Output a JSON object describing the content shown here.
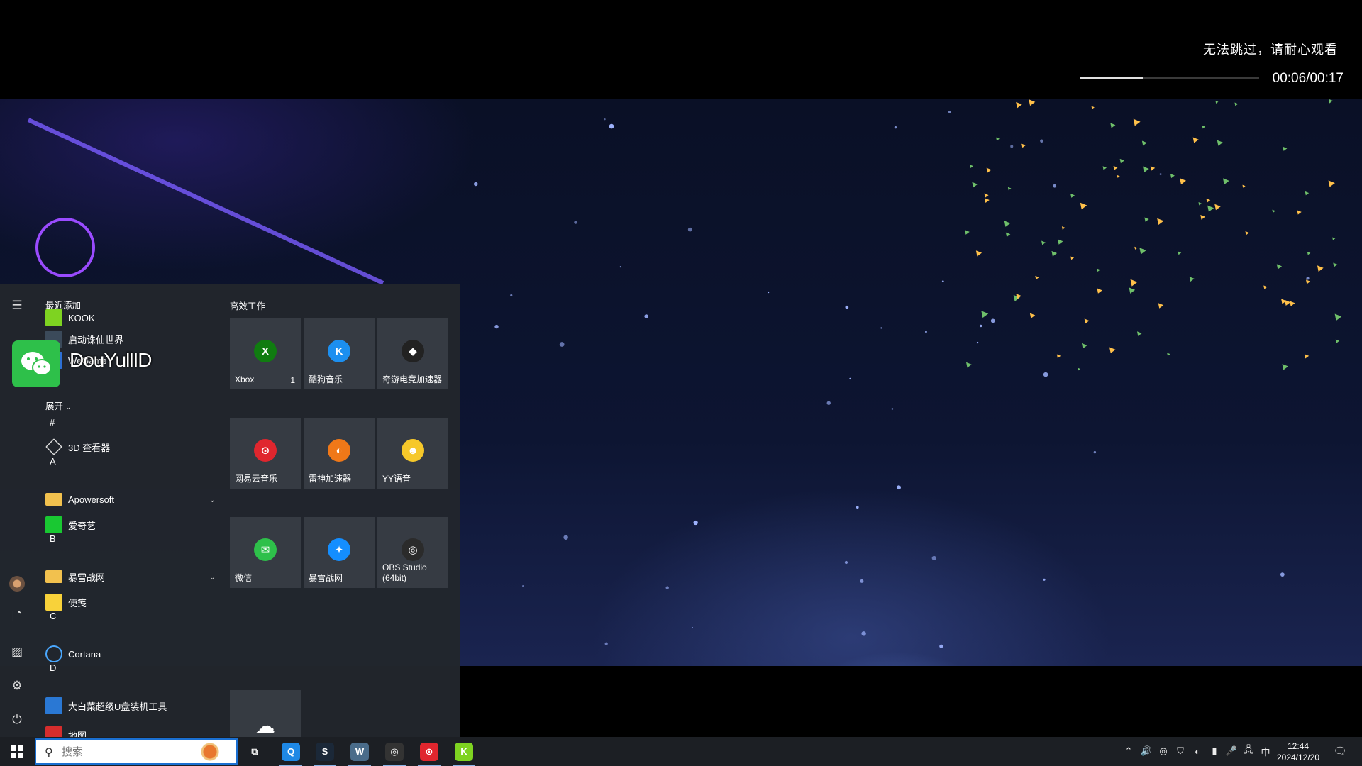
{
  "video": {
    "skip_notice": "无法跳过，请耐心观看",
    "time": "00:06/00:17",
    "progress": 0.35
  },
  "start_menu": {
    "recent_header": "最近添加",
    "expand_label": "展开",
    "recent": [
      {
        "label": "KOOK",
        "icon": "kook-icon",
        "color": "#7ed321"
      },
      {
        "label": "启动诛仙世界",
        "icon": "zhuxian-icon",
        "color": "#3b4a5a"
      },
      {
        "label": "WeGame",
        "icon": "wegame-icon",
        "color": "#2d6fd4"
      }
    ],
    "letters": [
      "#",
      "A",
      "B",
      "C",
      "D"
    ],
    "apps": [
      {
        "label": "3D 查看器",
        "icon": "cube-icon",
        "color": "transparent"
      },
      {
        "label": "Apowersoft",
        "icon": "folder-icon",
        "color": "#f2c14e",
        "expandable": true
      },
      {
        "label": "爱奇艺",
        "icon": "iqiyi-icon",
        "color": "#19c832"
      },
      {
        "label": "暴雪战网",
        "icon": "folder-icon",
        "color": "#f2c14e",
        "expandable": true
      },
      {
        "label": "便笺",
        "icon": "sticky-note-icon",
        "color": "#f8d23a"
      },
      {
        "label": "Cortana",
        "icon": "cortana-icon",
        "color": "transparent"
      },
      {
        "label": "大白菜超级U盘装机工具",
        "icon": "dabaicai-icon",
        "color": "#2a78d4"
      },
      {
        "label": "地图",
        "icon": "maps-icon",
        "color": "#d62d2d"
      }
    ],
    "group_title": "高效工作",
    "tiles": [
      {
        "label": "Xbox",
        "badge": "1",
        "icon": "xbox-icon",
        "color": "#107c10",
        "glyph": "X"
      },
      {
        "label": "酷狗音乐",
        "icon": "kugou-icon",
        "color": "#1c8ff0",
        "glyph": "K"
      },
      {
        "label": "奇游电竞加速器",
        "icon": "qiyou-icon",
        "color": "#222222",
        "glyph": "◆"
      },
      {
        "label": "网易云音乐",
        "icon": "netease-music-icon",
        "color": "#e0262e",
        "glyph": "⊙"
      },
      {
        "label": "雷神加速器",
        "icon": "leishen-icon",
        "color": "#f07818",
        "glyph": "◐"
      },
      {
        "label": "YY语音",
        "icon": "yy-icon",
        "color": "#f6c82a",
        "glyph": "☻"
      },
      {
        "label": "微信",
        "icon": "wechat-icon",
        "color": "#2ec04a",
        "glyph": "✉"
      },
      {
        "label": "暴雪战网",
        "icon": "battlenet-icon",
        "color": "#148eff",
        "glyph": "✦"
      },
      {
        "label": "OBS Studio (64bit)",
        "icon": "obs-icon",
        "color": "#2b2b2b",
        "glyph": "◎"
      },
      {
        "label": "",
        "icon": "onedrive-icon",
        "color": "transparent",
        "glyph": "☁"
      }
    ]
  },
  "overlay": {
    "name": "DouYullID",
    "icon": "wechat-icon"
  },
  "taskbar": {
    "search_placeholder": "搜索",
    "apps": [
      {
        "name": "task-view",
        "glyph": "⧉",
        "color": "transparent"
      },
      {
        "name": "browser",
        "glyph": "Q",
        "color": "#1e88e5"
      },
      {
        "name": "steam",
        "glyph": "S",
        "color": "#1b2838"
      },
      {
        "name": "wordpad",
        "glyph": "W",
        "color": "#4a6c8a"
      },
      {
        "name": "obs",
        "glyph": "◎",
        "color": "#333333"
      },
      {
        "name": "netease-music",
        "glyph": "⊙",
        "color": "#e0262e"
      },
      {
        "name": "kook",
        "glyph": "K",
        "color": "#7ed321"
      }
    ],
    "tray_lang": "中",
    "clock_time": "12:44",
    "clock_date": "2024/12/20"
  }
}
